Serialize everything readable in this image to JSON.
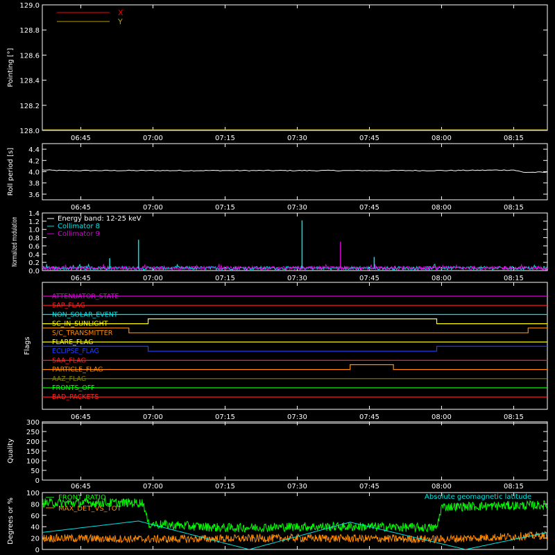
{
  "colors": {
    "background": "#000000",
    "axes": "#ffffff",
    "x_pointing": "#ff0000",
    "y_pointing": "#b5a000",
    "white": "#ffffff",
    "cyan": "#00e5e5",
    "magenta": "#e000e0",
    "green": "#00ff00",
    "orange": "#ff8c00"
  },
  "time_axis": {
    "start": "06:37",
    "end": "08:22",
    "ticks": [
      "06:45",
      "07:00",
      "07:15",
      "07:30",
      "07:45",
      "08:00",
      "08:15"
    ]
  },
  "chart_data": [
    {
      "id": "pointing",
      "type": "line",
      "ylabel": "Pointing [°]",
      "ylim": [
        128.0,
        129.0
      ],
      "yticks": [
        "128.0",
        "128.2",
        "128.4",
        "128.6",
        "128.8",
        "129.0"
      ],
      "legend": [
        {
          "name": "X",
          "color": "#ff0000"
        },
        {
          "name": "Y",
          "color": "#b5a000"
        }
      ],
      "series": [
        {
          "name": "X",
          "color": "#ff0000",
          "x": [
            "06:37",
            "08:22"
          ],
          "y": [
            null,
            null
          ]
        },
        {
          "name": "Y",
          "color": "#b5a000",
          "x": [
            "06:37",
            "08:22"
          ],
          "y": [
            128.0,
            128.0
          ]
        }
      ]
    },
    {
      "id": "roll_period",
      "type": "line",
      "ylabel": "Roll period [s]",
      "ylim": [
        3.5,
        4.5
      ],
      "yticks": [
        "3.6",
        "3.8",
        "4.0",
        "4.2",
        "4.4"
      ],
      "series": [
        {
          "color": "#ffffff",
          "x": [
            "06:37",
            "06:41",
            "07:00",
            "07:30",
            "07:45",
            "08:00",
            "08:15",
            "08:17",
            "08:22"
          ],
          "y": [
            4.03,
            4.02,
            4.02,
            4.02,
            4.02,
            4.02,
            4.03,
            3.99,
            3.99
          ]
        }
      ]
    },
    {
      "id": "modulation",
      "type": "line",
      "ylabel": "Normalized modulation",
      "ylim": [
        0.0,
        1.4
      ],
      "yticks": [
        "0.0",
        "0.2",
        "0.4",
        "0.6",
        "0.8",
        "1.0",
        "1.2",
        "1.4"
      ],
      "legend": [
        {
          "name": "Energy band: 12-25 keV",
          "color": "#ffffff"
        },
        {
          "name": "Collimator 8",
          "color": "#00e5e5"
        },
        {
          "name": "Collimator 9",
          "color": "#e000e0"
        }
      ],
      "baseline": 0.06,
      "spikes": [
        {
          "series": "Collimator 8",
          "x": "06:51",
          "y": 0.3
        },
        {
          "series": "Collimator 8",
          "x": "06:57",
          "y": 0.75
        },
        {
          "series": "Collimator 8",
          "x": "07:31",
          "y": 1.22
        },
        {
          "series": "Collimator 8",
          "x": "07:46",
          "y": 0.33
        },
        {
          "series": "Collimator 9",
          "x": "07:39",
          "y": 0.7
        }
      ]
    },
    {
      "id": "flags",
      "type": "step",
      "ylabel": "Flags",
      "flags": [
        {
          "name": "ATTENUATOR_STATE",
          "color": "#e000e0",
          "segments": [
            [
              "06:37",
              "08:22",
              0
            ]
          ]
        },
        {
          "name": "SAP_FLAG",
          "color": "#ff2020",
          "segments": [
            [
              "06:37",
              "08:22",
              0
            ]
          ]
        },
        {
          "name": "NON_SOLAR_EVENT",
          "color": "#00e5e5",
          "segments": [
            [
              "06:37",
              "08:22",
              0
            ]
          ]
        },
        {
          "name": "SC_IN_SUNLIGHT",
          "color": "#ffff00",
          "segments": [
            [
              "06:37",
              "06:59",
              0
            ],
            [
              "06:59",
              "07:59",
              1
            ],
            [
              "07:59",
              "08:22",
              0
            ]
          ]
        },
        {
          "name": "S/C_TRANSMITTER",
          "color": "#ff8c00",
          "segments": [
            [
              "06:37",
              "06:55",
              1
            ],
            [
              "06:55",
              "08:18",
              0
            ],
            [
              "08:18",
              "08:22",
              1
            ]
          ]
        },
        {
          "name": "FLARE_FLAG",
          "color": "#ffff00",
          "segments": [
            [
              "06:37",
              "08:22",
              0
            ]
          ]
        },
        {
          "name": "ECLIPSE_FLAG",
          "color": "#2040ff",
          "segments": [
            [
              "06:37",
              "06:59",
              1
            ],
            [
              "06:59",
              "07:59",
              0
            ],
            [
              "07:59",
              "08:22",
              1
            ]
          ]
        },
        {
          "name": "SAA_FLAG",
          "color": "#ff2020",
          "segments": [
            [
              "06:37",
              "08:22",
              0
            ]
          ]
        },
        {
          "name": "PARTICLE_FLAG",
          "color": "#ff8c00",
          "segments": [
            [
              "06:37",
              "07:41",
              0
            ],
            [
              "07:41",
              "07:50",
              1
            ],
            [
              "07:50",
              "08:22",
              0
            ]
          ]
        },
        {
          "name": "AAZ_FLAG",
          "color": "#808000",
          "segments": [
            [
              "06:37",
              "08:22",
              0
            ]
          ]
        },
        {
          "name": "FRONTS_OFF",
          "color": "#00ff00",
          "segments": [
            [
              "06:37",
              "08:22",
              0
            ]
          ]
        },
        {
          "name": "BAD_PACKETS",
          "color": "#ff2020",
          "segments": [
            [
              "06:37",
              "08:22",
              0
            ]
          ]
        }
      ]
    },
    {
      "id": "quality",
      "type": "line",
      "ylabel": "Quality",
      "ylim": [
        0,
        300
      ],
      "yticks": [
        "0",
        "50",
        "100",
        "150",
        "200",
        "250",
        "300"
      ],
      "series": [
        {
          "color": "#ffffff",
          "x": [
            "06:37",
            "08:22"
          ],
          "y": [
            300,
            300
          ]
        }
      ]
    },
    {
      "id": "ratios",
      "type": "line",
      "ylabel": "Degrees or %",
      "ylim": [
        0,
        100
      ],
      "yticks": [
        "0",
        "20",
        "40",
        "60",
        "80",
        "100"
      ],
      "legend": [
        {
          "name": "FRONT_RATIO",
          "color": "#00ff00"
        },
        {
          "name": "MAX_DET_VS_TOT",
          "color": "#ff8c00"
        },
        {
          "name": "Absolute geomagnetic latitude",
          "color": "#00e5e5"
        }
      ],
      "series": [
        {
          "name": "FRONT_RATIO",
          "color": "#00ff00",
          "x": [
            "06:37",
            "06:58",
            "06:59",
            "07:15",
            "07:30",
            "07:45",
            "07:59",
            "08:00",
            "08:22"
          ],
          "y": [
            82,
            82,
            45,
            38,
            40,
            40,
            38,
            75,
            78
          ]
        },
        {
          "name": "MAX_DET_VS_TOT",
          "color": "#ff8c00",
          "x": [
            "06:37",
            "07:00",
            "07:30",
            "08:00",
            "08:22"
          ],
          "y": [
            20,
            18,
            20,
            18,
            25
          ]
        },
        {
          "name": "Absolute geomagnetic latitude",
          "color": "#00e5e5",
          "x": [
            "06:37",
            "06:57",
            "07:20",
            "07:41",
            "08:05",
            "08:22"
          ],
          "y": [
            30,
            50,
            0,
            48,
            0,
            30
          ]
        }
      ]
    }
  ]
}
